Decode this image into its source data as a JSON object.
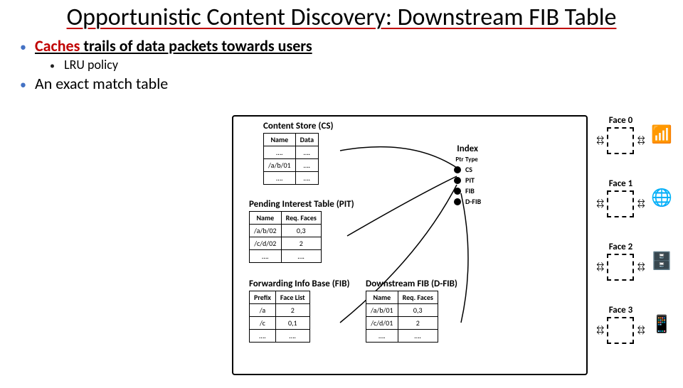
{
  "title": "Opportunistic Content Discovery:\nDownstream FIB Table",
  "bullets": {
    "b1_strong": "Caches",
    "b1_rest": " trails of data packets towards users",
    "b1_sub": "LRU policy",
    "b2": "An exact match table"
  },
  "diagram": {
    "cs": {
      "title": "Content Store (CS)",
      "headers": [
        "Name",
        "Data"
      ],
      "rows": [
        [
          "….",
          "…."
        ],
        [
          "/a/b/01",
          "…."
        ],
        [
          "….",
          "…."
        ]
      ]
    },
    "pit": {
      "title": "Pending Interest Table (PIT)",
      "headers": [
        "Name",
        "Req. Faces"
      ],
      "rows": [
        [
          "/a/b/02",
          "0,3"
        ],
        [
          "/c/d/02",
          "2"
        ],
        [
          "….",
          "…."
        ]
      ]
    },
    "fib": {
      "title": "Forwarding Info Base (FIB)",
      "headers": [
        "Prefix",
        "Face List"
      ],
      "rows": [
        [
          "/a",
          "2"
        ],
        [
          "/c",
          "0,1"
        ],
        [
          "….",
          "…."
        ]
      ]
    },
    "dfib": {
      "title": "Downstream FIB (D-FIB)",
      "headers": [
        "Name",
        "Req. Faces"
      ],
      "rows": [
        [
          "/a/b/01",
          "0,3"
        ],
        [
          "/c/d/01",
          "2"
        ],
        [
          "….",
          "…."
        ]
      ]
    },
    "index": {
      "title": "Index",
      "headers": [
        "Ptr",
        "Type"
      ],
      "items": [
        "CS",
        "PIT",
        "FIB",
        "D-FIB"
      ]
    },
    "faces": [
      "Face 0",
      "Face 1",
      "Face 2",
      "Face 3"
    ]
  }
}
